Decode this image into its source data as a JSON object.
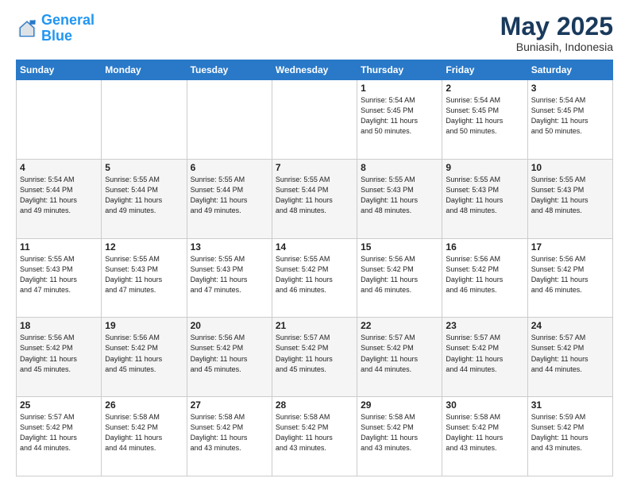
{
  "header": {
    "logo_general": "General",
    "logo_blue": "Blue",
    "month": "May 2025",
    "location": "Buniasih, Indonesia"
  },
  "days_of_week": [
    "Sunday",
    "Monday",
    "Tuesday",
    "Wednesday",
    "Thursday",
    "Friday",
    "Saturday"
  ],
  "weeks": [
    [
      {
        "day": "",
        "info": ""
      },
      {
        "day": "",
        "info": ""
      },
      {
        "day": "",
        "info": ""
      },
      {
        "day": "",
        "info": ""
      },
      {
        "day": "1",
        "info": "Sunrise: 5:54 AM\nSunset: 5:45 PM\nDaylight: 11 hours\nand 50 minutes."
      },
      {
        "day": "2",
        "info": "Sunrise: 5:54 AM\nSunset: 5:45 PM\nDaylight: 11 hours\nand 50 minutes."
      },
      {
        "day": "3",
        "info": "Sunrise: 5:54 AM\nSunset: 5:45 PM\nDaylight: 11 hours\nand 50 minutes."
      }
    ],
    [
      {
        "day": "4",
        "info": "Sunrise: 5:54 AM\nSunset: 5:44 PM\nDaylight: 11 hours\nand 49 minutes."
      },
      {
        "day": "5",
        "info": "Sunrise: 5:55 AM\nSunset: 5:44 PM\nDaylight: 11 hours\nand 49 minutes."
      },
      {
        "day": "6",
        "info": "Sunrise: 5:55 AM\nSunset: 5:44 PM\nDaylight: 11 hours\nand 49 minutes."
      },
      {
        "day": "7",
        "info": "Sunrise: 5:55 AM\nSunset: 5:44 PM\nDaylight: 11 hours\nand 48 minutes."
      },
      {
        "day": "8",
        "info": "Sunrise: 5:55 AM\nSunset: 5:43 PM\nDaylight: 11 hours\nand 48 minutes."
      },
      {
        "day": "9",
        "info": "Sunrise: 5:55 AM\nSunset: 5:43 PM\nDaylight: 11 hours\nand 48 minutes."
      },
      {
        "day": "10",
        "info": "Sunrise: 5:55 AM\nSunset: 5:43 PM\nDaylight: 11 hours\nand 48 minutes."
      }
    ],
    [
      {
        "day": "11",
        "info": "Sunrise: 5:55 AM\nSunset: 5:43 PM\nDaylight: 11 hours\nand 47 minutes."
      },
      {
        "day": "12",
        "info": "Sunrise: 5:55 AM\nSunset: 5:43 PM\nDaylight: 11 hours\nand 47 minutes."
      },
      {
        "day": "13",
        "info": "Sunrise: 5:55 AM\nSunset: 5:43 PM\nDaylight: 11 hours\nand 47 minutes."
      },
      {
        "day": "14",
        "info": "Sunrise: 5:55 AM\nSunset: 5:42 PM\nDaylight: 11 hours\nand 46 minutes."
      },
      {
        "day": "15",
        "info": "Sunrise: 5:56 AM\nSunset: 5:42 PM\nDaylight: 11 hours\nand 46 minutes."
      },
      {
        "day": "16",
        "info": "Sunrise: 5:56 AM\nSunset: 5:42 PM\nDaylight: 11 hours\nand 46 minutes."
      },
      {
        "day": "17",
        "info": "Sunrise: 5:56 AM\nSunset: 5:42 PM\nDaylight: 11 hours\nand 46 minutes."
      }
    ],
    [
      {
        "day": "18",
        "info": "Sunrise: 5:56 AM\nSunset: 5:42 PM\nDaylight: 11 hours\nand 45 minutes."
      },
      {
        "day": "19",
        "info": "Sunrise: 5:56 AM\nSunset: 5:42 PM\nDaylight: 11 hours\nand 45 minutes."
      },
      {
        "day": "20",
        "info": "Sunrise: 5:56 AM\nSunset: 5:42 PM\nDaylight: 11 hours\nand 45 minutes."
      },
      {
        "day": "21",
        "info": "Sunrise: 5:57 AM\nSunset: 5:42 PM\nDaylight: 11 hours\nand 45 minutes."
      },
      {
        "day": "22",
        "info": "Sunrise: 5:57 AM\nSunset: 5:42 PM\nDaylight: 11 hours\nand 44 minutes."
      },
      {
        "day": "23",
        "info": "Sunrise: 5:57 AM\nSunset: 5:42 PM\nDaylight: 11 hours\nand 44 minutes."
      },
      {
        "day": "24",
        "info": "Sunrise: 5:57 AM\nSunset: 5:42 PM\nDaylight: 11 hours\nand 44 minutes."
      }
    ],
    [
      {
        "day": "25",
        "info": "Sunrise: 5:57 AM\nSunset: 5:42 PM\nDaylight: 11 hours\nand 44 minutes."
      },
      {
        "day": "26",
        "info": "Sunrise: 5:58 AM\nSunset: 5:42 PM\nDaylight: 11 hours\nand 44 minutes."
      },
      {
        "day": "27",
        "info": "Sunrise: 5:58 AM\nSunset: 5:42 PM\nDaylight: 11 hours\nand 43 minutes."
      },
      {
        "day": "28",
        "info": "Sunrise: 5:58 AM\nSunset: 5:42 PM\nDaylight: 11 hours\nand 43 minutes."
      },
      {
        "day": "29",
        "info": "Sunrise: 5:58 AM\nSunset: 5:42 PM\nDaylight: 11 hours\nand 43 minutes."
      },
      {
        "day": "30",
        "info": "Sunrise: 5:58 AM\nSunset: 5:42 PM\nDaylight: 11 hours\nand 43 minutes."
      },
      {
        "day": "31",
        "info": "Sunrise: 5:59 AM\nSunset: 5:42 PM\nDaylight: 11 hours\nand 43 minutes."
      }
    ]
  ]
}
